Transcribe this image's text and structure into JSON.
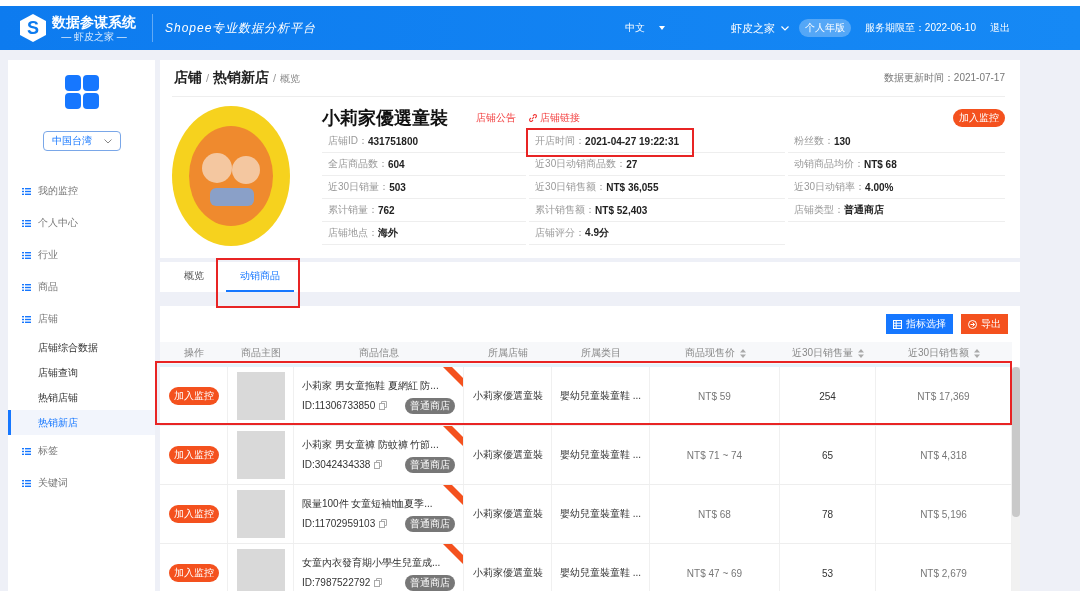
{
  "header": {
    "logo_letter": "S",
    "title": "数据参谋系统",
    "subtitle": "— 虾皮之家 —",
    "slogan": "Shopee专业数据分析平台",
    "language": "中文",
    "account": "虾皮之家",
    "plan_badge": "个人年版",
    "service_expiry": "服务期限至：2022-06-10",
    "logout": "退出"
  },
  "sidebar": {
    "region_select": "中国台湾",
    "menu": [
      {
        "label": "我的监控",
        "selected": false
      },
      {
        "label": "个人中心",
        "selected": false
      },
      {
        "label": "行业",
        "selected": false
      },
      {
        "label": "商品",
        "selected": false
      },
      {
        "label": "店铺",
        "selected": false,
        "children": [
          {
            "label": "店铺综合数据",
            "selected": false
          },
          {
            "label": "店铺查询",
            "selected": false
          },
          {
            "label": "热销店铺",
            "selected": false
          },
          {
            "label": "热销新店",
            "selected": true
          }
        ]
      },
      {
        "label": "标签",
        "selected": false
      },
      {
        "label": "关键词",
        "selected": false
      }
    ]
  },
  "page": {
    "breadcrumb": [
      {
        "text": "店铺",
        "kind": "link"
      },
      {
        "text": "/",
        "kind": "separator"
      },
      {
        "text": "热销新店",
        "kind": "link"
      },
      {
        "text": "/",
        "kind": "separator"
      },
      {
        "text": "概览",
        "kind": "current"
      }
    ],
    "data_update": "数据更新时间：2021-07-17"
  },
  "shop": {
    "name": "小莉家優選童裝",
    "notice_link": "店铺公告",
    "shop_link": "店铺链接",
    "monitor_button": "加入监控",
    "info_columns": [
      [
        {
          "label": "店铺ID：",
          "value": "431751800",
          "highlighted": false
        },
        {
          "label": "全店商品数：",
          "value": "604",
          "highlighted": false
        },
        {
          "label": "近30日销量：",
          "value": "503",
          "highlighted": false
        },
        {
          "label": "累计销量：",
          "value": "762",
          "highlighted": false
        },
        {
          "label": "店铺地点：",
          "value": "海外",
          "highlighted": false
        }
      ],
      [
        {
          "label": "开店时间：",
          "value": "2021-04-27 19:22:31",
          "highlighted": true
        },
        {
          "label": "近30日动销商品数：",
          "value": "27",
          "highlighted": false
        },
        {
          "label": "近30日销售额：",
          "value": "NT$ 36,055",
          "highlighted": false
        },
        {
          "label": "累计销售额：",
          "value": "NT$ 52,403",
          "highlighted": false
        },
        {
          "label": "店铺评分：",
          "value": "4.9分",
          "highlighted": false
        }
      ],
      [
        {
          "label": "粉丝数：",
          "value": "130",
          "highlighted": false
        },
        {
          "label": "动销商品均价：",
          "value": "NT$ 68",
          "highlighted": false
        },
        {
          "label": "近30日动销率：",
          "value": "4.00%",
          "highlighted": false
        },
        {
          "label": "店铺类型：",
          "value": "普通商店",
          "highlighted": false
        }
      ]
    ]
  },
  "tabs": [
    {
      "label": "概览",
      "selected": false,
      "highlighted": false
    },
    {
      "label": "动销商品",
      "selected": true,
      "highlighted": true
    }
  ],
  "toolbar": [
    {
      "label": "指标选择",
      "kind": "columns"
    },
    {
      "label": "导出",
      "kind": "export"
    }
  ],
  "table": {
    "columns": [
      {
        "label": "操作",
        "sortable": false
      },
      {
        "label": "商品主图",
        "sortable": false
      },
      {
        "label": "商品信息",
        "sortable": false
      },
      {
        "label": "所属店铺",
        "sortable": false
      },
      {
        "label": "所属类目",
        "sortable": false
      },
      {
        "label": "商品现售价",
        "sortable": true
      },
      {
        "label": "近30日销售量",
        "sortable": true
      },
      {
        "label": "近30日销售额",
        "sortable": true
      }
    ],
    "rows": [
      {
        "action": "加入监控",
        "title": "小莉家 男女童拖鞋 夏網紅 防...",
        "id": "ID:11306733850",
        "badge": "普通商店",
        "store": "小莉家優選童裝",
        "category": "嬰幼兒童裝童鞋 ...",
        "price": "NT$ 59",
        "sold_30d": "254",
        "sales_30d": "NT$ 17,369",
        "highlighted": true
      },
      {
        "action": "加入监控",
        "title": "小莉家 男女童褲 防蚊褲 竹節...",
        "id": "ID:3042434338",
        "badge": "普通商店",
        "store": "小莉家優選童裝",
        "category": "嬰幼兒童裝童鞋 ...",
        "price": "NT$ 71 ~ 74",
        "sold_30d": "65",
        "sales_30d": "NT$ 4,318",
        "highlighted": false
      },
      {
        "action": "加入监控",
        "title": "限量100件 女童短袖t恤夏季...",
        "id": "ID:11702959103",
        "badge": "普通商店",
        "store": "小莉家優選童裝",
        "category": "嬰幼兒童裝童鞋 ...",
        "price": "NT$ 68",
        "sold_30d": "78",
        "sales_30d": "NT$ 5,196",
        "highlighted": false
      },
      {
        "action": "加入监控",
        "title": "女童內衣發育期小學生兒童成...",
        "id": "ID:7987522792",
        "badge": "普通商店",
        "store": "小莉家優選童裝",
        "category": "嬰幼兒童裝童鞋 ...",
        "price": "NT$ 47 ~ 69",
        "sold_30d": "53",
        "sales_30d": "NT$ 2,679",
        "highlighted": false
      }
    ]
  }
}
